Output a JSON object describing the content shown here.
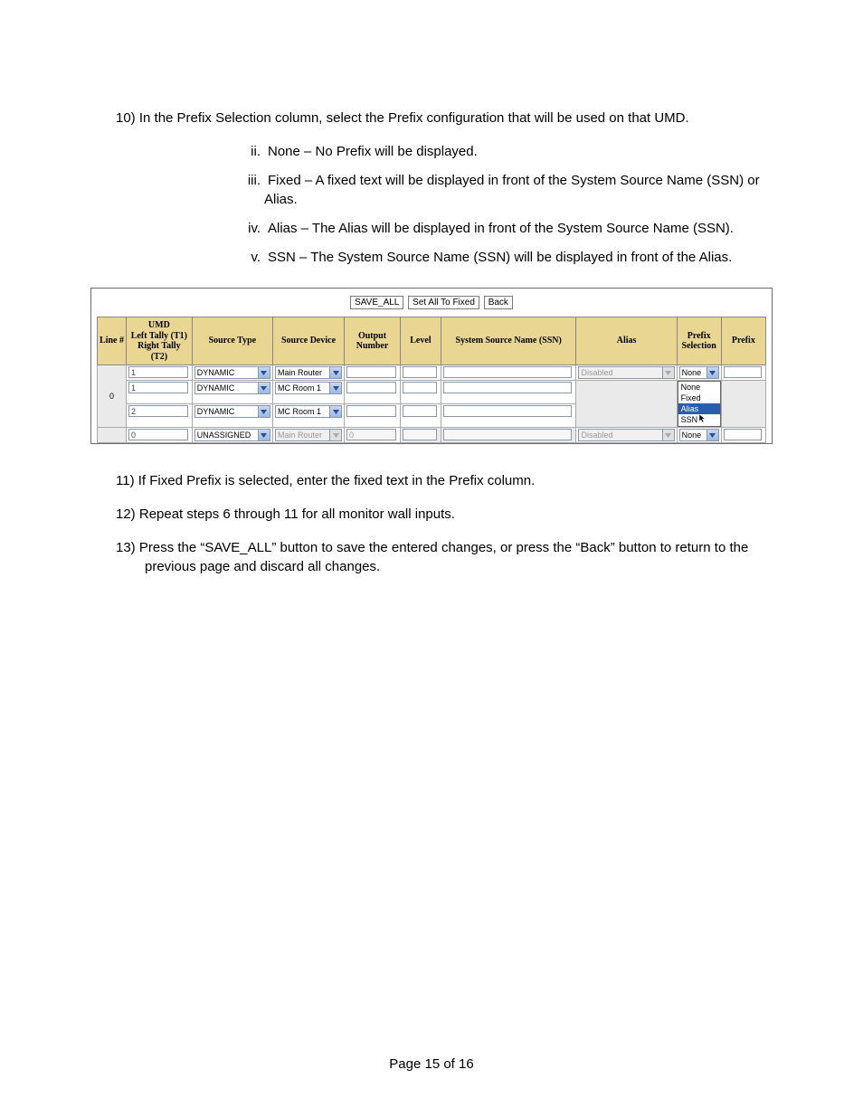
{
  "step10": {
    "num": "10)",
    "text": "In the Prefix Selection column, select the Prefix configuration that will be used on that UMD.",
    "items": [
      {
        "marker": "ii.",
        "text": "None – No Prefix will be displayed."
      },
      {
        "marker": "iii.",
        "text": "Fixed – A fixed text will be displayed in front of the System Source Name (SSN) or Alias."
      },
      {
        "marker": "iv.",
        "text": "Alias – The Alias will be displayed in front of the System Source Name (SSN)."
      },
      {
        "marker": "v.",
        "text": "SSN – The System Source Name (SSN) will be displayed in front of the Alias."
      }
    ]
  },
  "step11": {
    "num": "11)",
    "text": "If Fixed Prefix is selected, enter the fixed text in the Prefix column."
  },
  "step12": {
    "num": "12)",
    "text": "Repeat steps 6 through 11 for all monitor wall inputs."
  },
  "step13": {
    "num": "13)",
    "text": "Press the “SAVE_ALL” button to save the entered changes, or press the “Back” button to return to the previous page and discard all changes."
  },
  "figure": {
    "buttons": {
      "save": "SAVE_ALL",
      "setfixed": "Set All To Fixed",
      "back": "Back"
    },
    "headers": {
      "line": "Line #",
      "umd": "UMD\nLeft Tally (T1)\nRight Tally (T2)",
      "sourceType": "Source Type",
      "sourceDevice": "Source Device",
      "outputNumber": "Output Number",
      "level": "Level",
      "ssn": "System Source Name (SSN)",
      "alias": "Alias",
      "prefixSel": "Prefix Selection",
      "prefix": "Prefix"
    },
    "rows": [
      {
        "line": "",
        "umd": "1",
        "sourceType": "DYNAMIC",
        "sourceDevice": "Main Router",
        "outputNumber": "",
        "level": "",
        "ssn": "",
        "alias": "Disabled",
        "aliasDisabled": true,
        "prefixSel": "None",
        "prefix": ""
      },
      {
        "line": "0",
        "umd": "1",
        "sourceType": "DYNAMIC",
        "sourceDevice": "MC Room 1",
        "outputNumber": "",
        "level": "",
        "ssn": "",
        "alias": "",
        "aliasHidden": true,
        "prefixSelOpen": true,
        "prefix": ""
      },
      {
        "line": "",
        "umd": "2",
        "sourceType": "DYNAMIC",
        "sourceDevice": "MC Room 1",
        "outputNumber": "",
        "level": "",
        "ssn": "",
        "alias": "",
        "aliasHidden": true,
        "prefixSel": "",
        "prefixHiddenByDrop": true
      },
      {
        "line": "",
        "umd": "0",
        "sourceType": "UNASSIGNED",
        "sourceDevice": "Main Router",
        "sourceDeviceDisabled": true,
        "outputNumber": "0",
        "outputDisabled": true,
        "level": "",
        "ssn": "",
        "alias": "Disabled",
        "aliasDisabled": true,
        "prefixSel": "None",
        "prefix": ""
      }
    ],
    "dropdownOptions": [
      "None",
      "Fixed",
      "Alias",
      "SSN"
    ],
    "dropdownSelected": "Alias"
  },
  "footer": "Page 15 of 16"
}
